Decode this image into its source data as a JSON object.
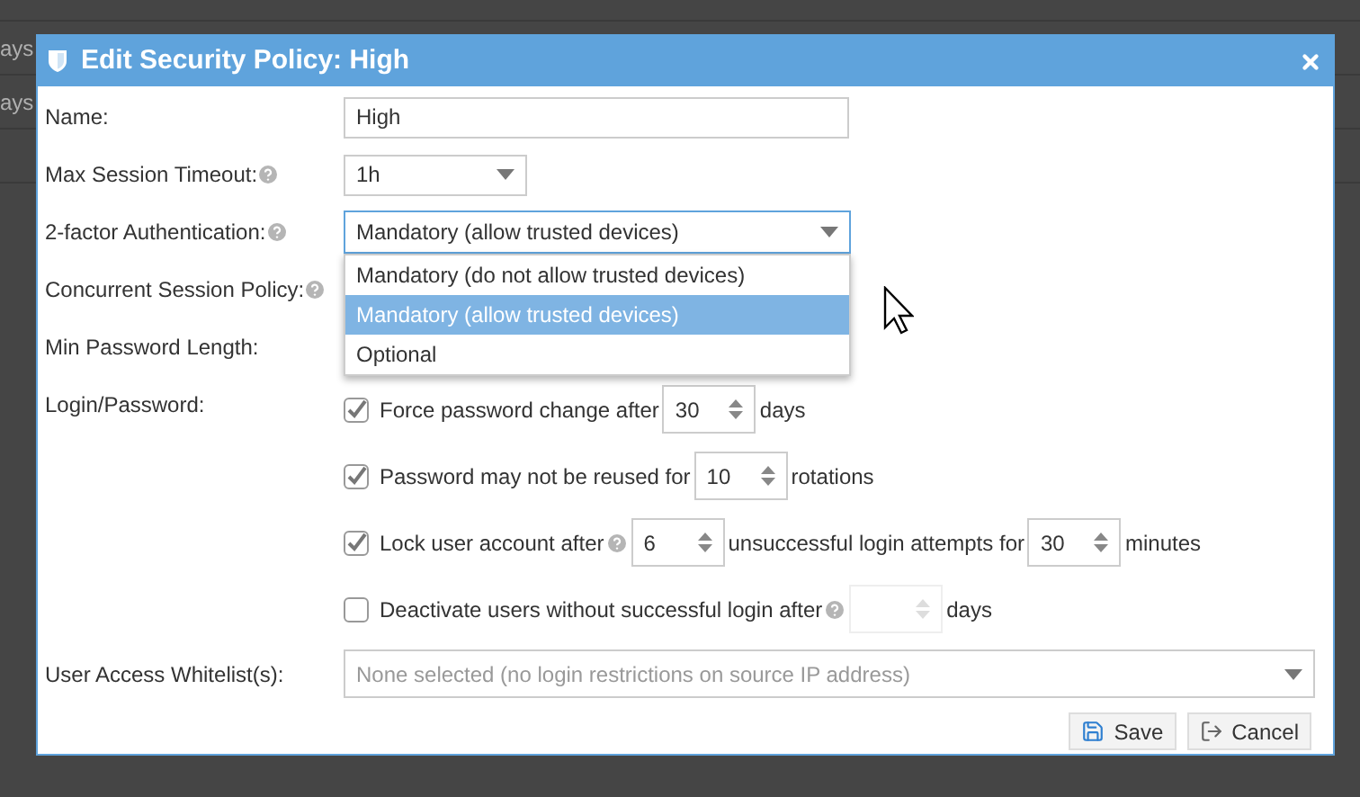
{
  "background": {
    "rows": [
      {
        "cell": "ays"
      },
      {
        "cell": "ays"
      }
    ]
  },
  "dialog": {
    "title": "Edit Security Policy: High",
    "fields": [
      {
        "kind": "text",
        "label": "Name:",
        "help": false,
        "value": "High"
      },
      {
        "kind": "select",
        "label": "Max Session Timeout:",
        "help": true,
        "value": "1h"
      },
      {
        "kind": "select_open",
        "label": "2-factor Authentication:",
        "help": true,
        "value": "Mandatory (allow trusted devices)",
        "options": [
          {
            "label": "Mandatory (do not allow trusted devices)",
            "selected": false
          },
          {
            "label": "Mandatory (allow trusted devices)",
            "selected": true
          },
          {
            "label": "Optional",
            "selected": false
          }
        ]
      },
      {
        "kind": "label_only",
        "label": "Concurrent Session Policy:",
        "help": true
      },
      {
        "kind": "label_only",
        "label": "Min Password Length:",
        "help": false
      },
      {
        "kind": "checks",
        "label": "Login/Password:",
        "help": false,
        "items": [
          {
            "checked": true,
            "parts": [
              {
                "kind": "text",
                "text": "Force password change after"
              },
              {
                "kind": "spinner",
                "value": "30",
                "disabled": false
              },
              {
                "kind": "text",
                "text": "days"
              }
            ]
          },
          {
            "checked": true,
            "parts": [
              {
                "kind": "text",
                "text": "Password may not be reused for"
              },
              {
                "kind": "spinner",
                "value": "10",
                "disabled": false
              },
              {
                "kind": "text",
                "text": "rotations"
              }
            ]
          },
          {
            "checked": true,
            "parts": [
              {
                "kind": "text",
                "text": "Lock user account after"
              },
              {
                "kind": "help"
              },
              {
                "kind": "spinner",
                "value": "6",
                "disabled": false
              },
              {
                "kind": "text",
                "text": "unsuccessful login attempts for"
              },
              {
                "kind": "spinner",
                "value": "30",
                "disabled": false
              },
              {
                "kind": "text",
                "text": "minutes"
              }
            ]
          },
          {
            "checked": false,
            "parts": [
              {
                "kind": "text",
                "text": "Deactivate users without successful login after"
              },
              {
                "kind": "help"
              },
              {
                "kind": "spinner",
                "disabled": true
              },
              {
                "kind": "text",
                "text": "days"
              }
            ]
          }
        ]
      },
      {
        "kind": "multiselect",
        "label": "User Access Whitelist(s):",
        "help": false,
        "placeholder": "None selected (no login restrictions on source IP address)"
      }
    ],
    "buttons": [
      {
        "kind": "save",
        "label": "Save"
      },
      {
        "kind": "cancel",
        "label": "Cancel"
      }
    ]
  }
}
